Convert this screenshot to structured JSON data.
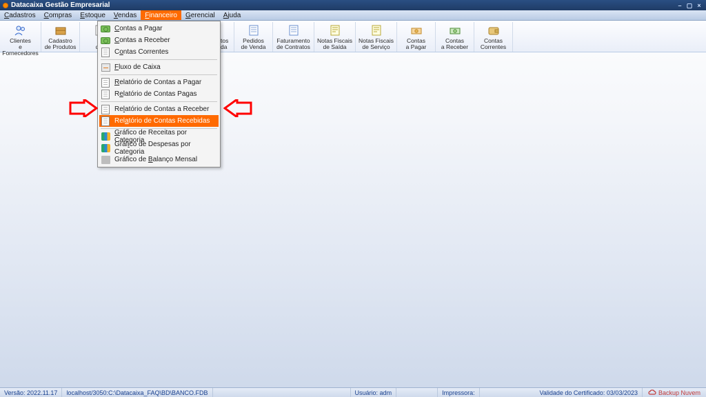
{
  "title": "Datacaixa Gestão Empresarial",
  "menubar": [
    "Cadastros",
    "Compras",
    "Estoque",
    "Vendas",
    "Financeiro",
    "Gerencial",
    "Ajuda"
  ],
  "menubar_active_index": 4,
  "toolbar": [
    {
      "label1": "Clientes",
      "label2": "e Fornecedores",
      "icon": "people"
    },
    {
      "label1": "Cadastro",
      "label2": "de Produtos",
      "icon": "box"
    },
    {
      "label1": "F",
      "label2": "de",
      "icon": "doc"
    },
    {
      "label1": "",
      "label2": "",
      "icon": ""
    },
    {
      "label1": "",
      "label2": "",
      "icon": ""
    },
    {
      "label1": "rçamentos",
      "label2": "de Venda",
      "icon": "sheet"
    },
    {
      "label1": "Pedidos",
      "label2": "de Venda",
      "icon": "sheet"
    },
    {
      "label1": "Faturamento",
      "label2": "de Contratos",
      "icon": "sheet"
    },
    {
      "label1": "Notas Fiscais",
      "label2": "de Saída",
      "icon": "nf"
    },
    {
      "label1": "Notas Fiscais",
      "label2": "de Serviço",
      "icon": "nf"
    },
    {
      "label1": "Contas",
      "label2": "a Pagar",
      "icon": "money-out"
    },
    {
      "label1": "Contas",
      "label2": "a Receber",
      "icon": "money-in"
    },
    {
      "label1": "Contas",
      "label2": "Correntes",
      "icon": "wallet"
    }
  ],
  "dropdown": {
    "items": [
      {
        "label": "Contas a Pagar",
        "u": 0,
        "icon": "cash"
      },
      {
        "label": "Contas a Receber",
        "u": 0,
        "icon": "cash"
      },
      {
        "label": "Contas Correntes",
        "u": 1,
        "icon": "doc"
      },
      {
        "sep": true
      },
      {
        "label": "Fluxo de Caixa",
        "u": 0,
        "icon": "flow"
      },
      {
        "sep": true
      },
      {
        "label": "Relatório de Contas a Pagar",
        "u": 0,
        "icon": "doc"
      },
      {
        "label": "Relatório de Contas Pagas",
        "u": 1,
        "icon": "doc"
      },
      {
        "sep": true
      },
      {
        "label": "Relatório de Contas a Receber",
        "u": 2,
        "icon": "doc"
      },
      {
        "label": "Relatório de Contas Recebidas",
        "u": 3,
        "icon": "doc",
        "hi": true
      },
      {
        "sep": true
      },
      {
        "label": "Gráfico de Receitas por Categoria",
        "u": 0,
        "icon": "chart"
      },
      {
        "label": "Gráfico de Despesas por Categoria",
        "u": 4,
        "icon": "chart"
      },
      {
        "label": "Gráfico de Balanço Mensal",
        "u": 11,
        "icon": "balance"
      }
    ]
  },
  "statusbar": {
    "version_label": "Versão:",
    "version": "2022.11.17",
    "host": "localhost/3050:C:\\Datacaixa_FAQ\\BD\\BANCO.FDB",
    "user_label": "Usuário:",
    "user": "adm",
    "printer_label": "Impressora:",
    "cert_label": "Validade do Certificado:",
    "cert": "03/03/2023",
    "backup": "Backup Nuvem"
  }
}
